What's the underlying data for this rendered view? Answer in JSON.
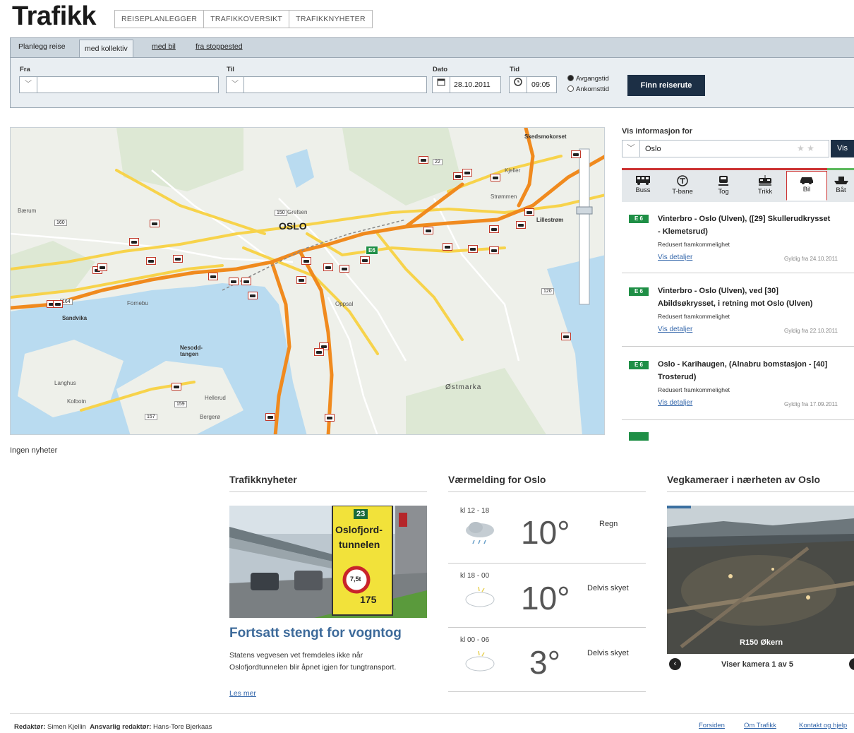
{
  "header": {
    "brand": "Trafikk",
    "nav": [
      "REISEPLANLEGGER",
      "TRAFIKKOVERSIKT",
      "TRAFIKKNYHETER"
    ]
  },
  "planner": {
    "tabs": {
      "label": "Planlegg reise",
      "kollektiv": "med kollektiv",
      "bil": "med bil",
      "stoppested": "fra stoppested"
    },
    "fra_label": "Fra",
    "til_label": "Til",
    "dato_label": "Dato",
    "dato_value": "28.10.2011",
    "tid_label": "Tid",
    "tid_value": "09:05",
    "radio_avgang": "Avgangstid",
    "radio_ankomst": "Ankomsttid",
    "submit": "Finn reiserute"
  },
  "map": {
    "city_label": "OSLO",
    "places": [
      "Kjeller",
      "Lillestrøm",
      "Sandvika",
      "Nesodd-tangen",
      "Østmarka",
      "Hellerud",
      "Bergerø",
      "Oppsal",
      "Grefsen",
      "Bærum",
      "Skedsmokorset",
      "Strømmen",
      "Fornebu",
      "Langhus",
      "Kolbotn"
    ],
    "road_shield": "E6",
    "road_numbers": [
      "160",
      "150",
      "120",
      "159",
      "157",
      "164",
      "22"
    ]
  },
  "info": {
    "label": "Vis informasjon for",
    "location": "Oslo",
    "vis_button": "Vis",
    "modes": [
      "Buss",
      "T-bane",
      "Tog",
      "Trikk",
      "Bil",
      "Båt"
    ],
    "items": [
      {
        "road": "E 6",
        "title_1": "Vinterbro - Oslo (Ulven), ([29] Skullerudkrysset",
        "title_2": "- Klemetsrud)",
        "status": "Redusert framkommelighet",
        "link": "Vis detaljer",
        "date": "Gyldig fra 24.10.2011"
      },
      {
        "road": "E 6",
        "title_1": "Vinterbro - Oslo (Ulven), ved [30]",
        "title_2": "Abildsøkrysset, i retning mot Oslo (Ulven)",
        "status": "Redusert framkommelighet",
        "link": "Vis detaljer",
        "date": "Gyldig fra 22.10.2011"
      },
      {
        "road": "E 6",
        "title_1": "Oslo - Karihaugen, (Alnabru bomstasjon - [40]",
        "title_2": "Trosterud)",
        "status": "Redusert framkommelighet",
        "link": "Vis detaljer",
        "date": "Gyldig fra 17.09.2011"
      }
    ]
  },
  "no_news": "Ingen nyheter",
  "news": {
    "heading": "Trafikknyheter",
    "sign_number": "23",
    "sign_line1": "Oslofjord-",
    "sign_line2": "tunnelen",
    "sign_weight": "7,5t",
    "sign_distance": "175",
    "headline": "Fortsatt stengt for vogntog",
    "body": "Statens vegvesen vet fremdeles ikke når Oslofjordtunnelen blir åpnet igjen for tungtransport.",
    "link": "Les mer"
  },
  "weather": {
    "heading": "Værmelding for Oslo",
    "rows": [
      {
        "time": "kl 12 - 18",
        "temp": "10°",
        "desc": "Regn"
      },
      {
        "time": "kl 18 - 00",
        "temp": "10°",
        "desc": "Delvis skyet"
      },
      {
        "time": "kl 00 - 06",
        "temp": "3°",
        "desc": "Delvis skyet"
      }
    ]
  },
  "cameras": {
    "heading": "Vegkameraer i nærheten av Oslo",
    "caption": "R150 Økern",
    "counter": "Viser kamera 1 av 5"
  },
  "footer": {
    "editor_label": "Redaktør:",
    "editor": "Simen Kjellin",
    "resp_label": "Ansvarlig redaktør:",
    "resp": "Hans-Tore Bjerkaas",
    "links": [
      "Forsiden",
      "Om Trafikk",
      "Kontakt og hjelp"
    ]
  },
  "colors": {
    "accent_dark": "#1c2f45",
    "road_orange": "#f08a1e",
    "road_yellow": "#f7d34b",
    "water": "#b9dbf0",
    "green_badge": "#1f8f46",
    "link": "#3366aa"
  }
}
